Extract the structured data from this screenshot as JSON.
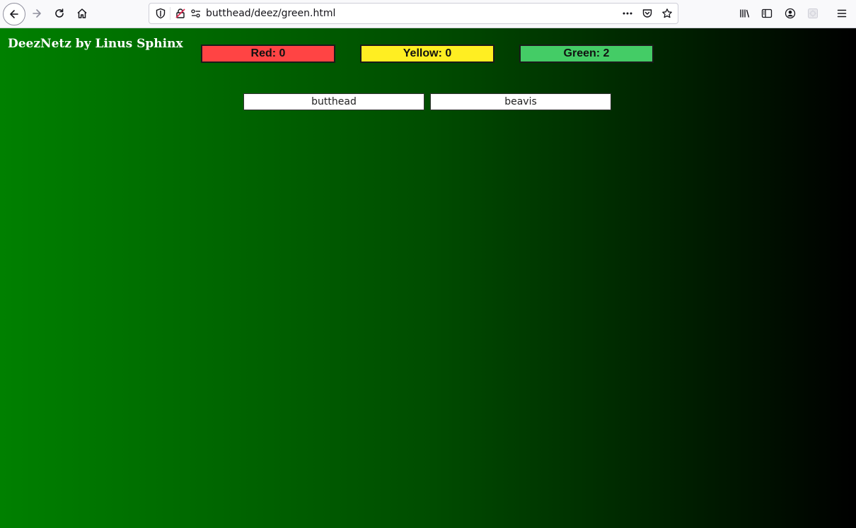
{
  "browser": {
    "url": "butthead/deez/green.html",
    "icons": {
      "back": "back-arrow-icon",
      "forward": "forward-arrow-icon",
      "reload": "reload-icon",
      "home": "home-icon",
      "tracking": "shield-icon",
      "insecure": "insecure-lock-icon",
      "permissions": "permissions-icon",
      "more": "more-dots-icon",
      "pocket": "pocket-icon",
      "bookmark": "star-icon",
      "library": "library-icon",
      "sidebar": "sidebar-icon",
      "account": "account-icon",
      "extension": "extension-icon",
      "menu": "hamburger-menu-icon"
    }
  },
  "page": {
    "title": "DeezNetz by Linus Sphinx",
    "background": {
      "from": "#008000",
      "to": "#000000"
    },
    "status": {
      "red": {
        "label": "Red: 0",
        "color": "#ff4444"
      },
      "yellow": {
        "label": "Yellow: 0",
        "color": "#ffee22"
      },
      "green": {
        "label": "Green: 2",
        "color": "#44cc66"
      }
    },
    "hosts": [
      {
        "name": "butthead"
      },
      {
        "name": "beavis"
      }
    ]
  }
}
